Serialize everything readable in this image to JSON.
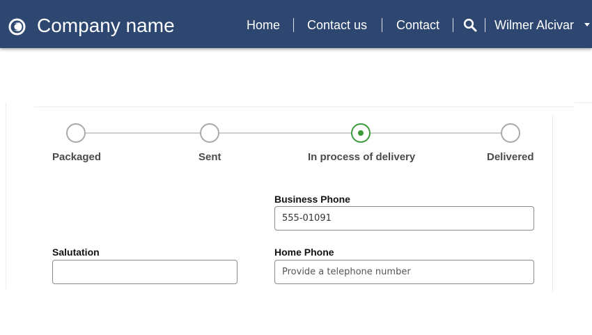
{
  "header": {
    "company_name": "Company name",
    "logo_icon": "circle-logo-icon",
    "background_color": "#2d4770",
    "nav": [
      {
        "label": "Home"
      },
      {
        "label": "Contact us"
      },
      {
        "label": "Contact"
      }
    ],
    "search_icon": "search-icon",
    "user": {
      "name": "Wilmer Alcivar",
      "menu_icon": "chevron-down-icon"
    }
  },
  "progress": {
    "active_color": "#3a9a3a",
    "current_step_index": 2,
    "steps": [
      {
        "label": "Packaged",
        "state": "inactive"
      },
      {
        "label": "Sent",
        "state": "inactive"
      },
      {
        "label": "In process of delivery",
        "state": "active"
      },
      {
        "label": "Delivered",
        "state": "inactive"
      }
    ]
  },
  "form": {
    "business_phone": {
      "label": "Business Phone",
      "value": "555-01091",
      "placeholder": ""
    },
    "salutation": {
      "label": "Salutation",
      "value": "",
      "placeholder": ""
    },
    "home_phone": {
      "label": "Home Phone",
      "value": "",
      "placeholder": "Provide a telephone number"
    }
  }
}
